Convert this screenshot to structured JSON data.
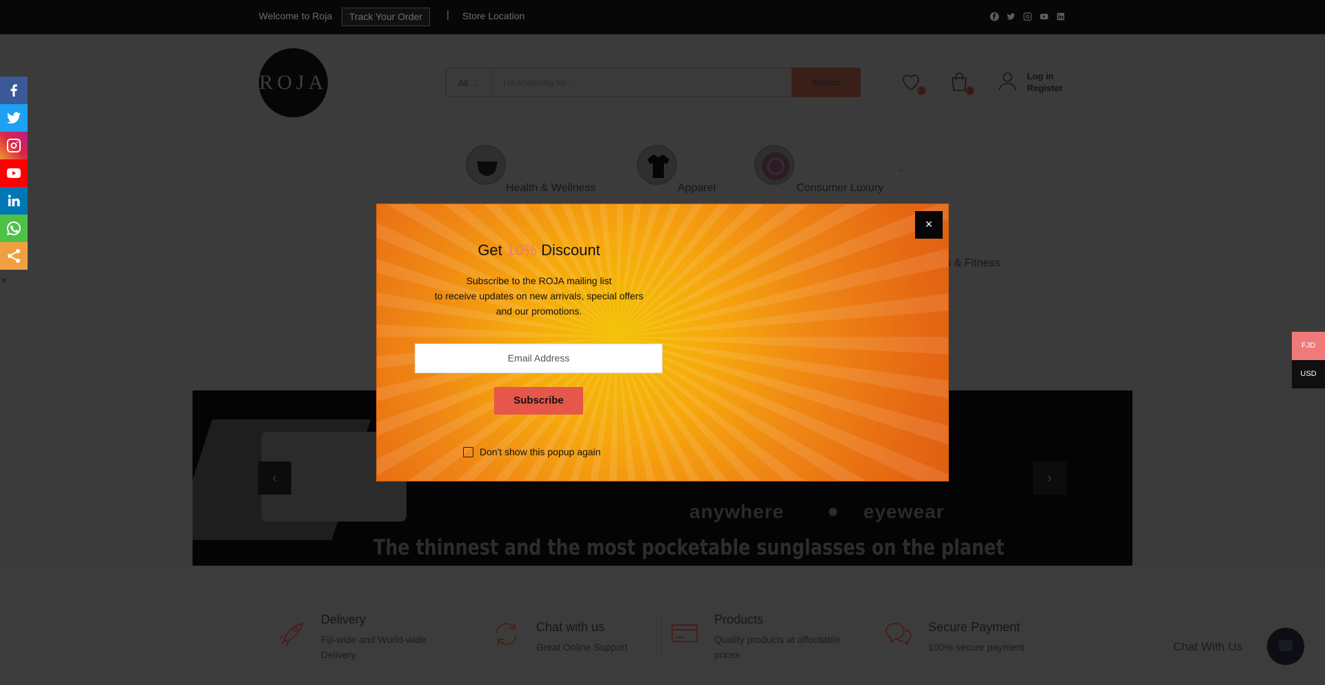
{
  "topbar": {
    "welcome": "Welcome to Roja",
    "track_order": "Track Your Order",
    "separator": "|",
    "store_location": "Store Location",
    "social_icons": [
      "facebook-icon",
      "twitter-icon",
      "instagram-icon",
      "youtube-icon",
      "linkedin-icon"
    ]
  },
  "header": {
    "logo_text": "ROJA",
    "search": {
      "category": "All",
      "placeholder": "I'm shopping for...",
      "button": "Search"
    },
    "wishlist_count": "0",
    "cart_count": "0",
    "login": "Log in",
    "register": "Register"
  },
  "categories": [
    {
      "label": "Health & Wellness",
      "icon": "mask-icon"
    },
    {
      "label": "Apparel",
      "icon": "shirt-icon"
    },
    {
      "label": "Consumer Luxury",
      "icon": "luxury-icon"
    }
  ],
  "category_partial": "s & Fitness",
  "banner": {
    "tagline_left": "anywhere",
    "tagline_right": "eyewear",
    "slogan": "The thinnest and the most pocketable sunglasses on the planet"
  },
  "features": [
    {
      "title": "Delivery",
      "desc": "Fiji-wide and World-wide Delivery",
      "icon": "rocket-icon"
    },
    {
      "title": "Chat with us",
      "desc": "Great Online Support",
      "icon": "refresh-icon"
    },
    {
      "title": "Products",
      "desc": "Quality products at affordable prices",
      "icon": "card-icon"
    },
    {
      "title": "Secure Payment",
      "desc": "100% secure payment",
      "icon": "chat-bubbles-icon"
    }
  ],
  "chat_widget": {
    "label": "Chat With Us"
  },
  "currency": {
    "options": [
      "FJD",
      "USD"
    ],
    "selected": "FJD",
    "selected_color": "#f07a7a",
    "other_color": "#0f0f0f"
  },
  "share_bar": {
    "items": [
      {
        "name": "facebook",
        "color": "#3b5998"
      },
      {
        "name": "twitter",
        "color": "#1da1f2"
      },
      {
        "name": "instagram",
        "color": "#d6249f"
      },
      {
        "name": "youtube",
        "color": "#ff0000"
      },
      {
        "name": "linkedin",
        "color": "#0077b5"
      },
      {
        "name": "whatsapp",
        "color": "#4dc247"
      },
      {
        "name": "share",
        "color": "#f0a040"
      }
    ]
  },
  "popup": {
    "title_before": "Get",
    "title_pct": "10%",
    "title_after": "Discount",
    "desc_line1": "Subscribe to the ROJA mailing list",
    "desc_line2": "to receive updates on new arrivals, special offers",
    "desc_line3": "and our promotions.",
    "email_placeholder": "Email Address",
    "subscribe": "Subscribe",
    "dont_show": "Don't show this popup again",
    "close_symbol": "×",
    "accent_color": "#f07a63",
    "button_color": "#e5574a"
  }
}
